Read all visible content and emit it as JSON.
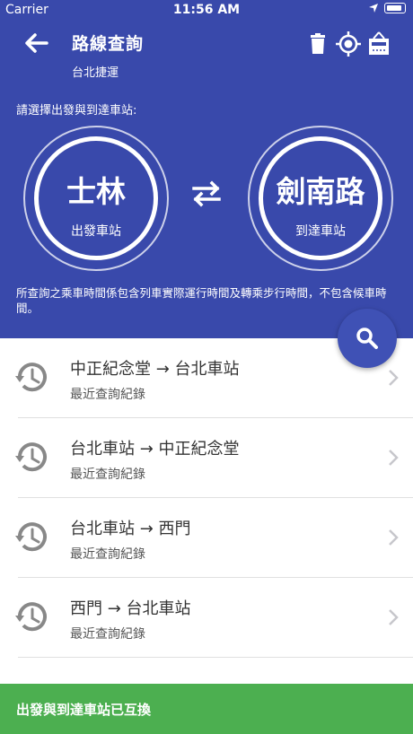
{
  "status_bar": {
    "carrier": "Carrier",
    "time": "11:56 AM"
  },
  "header": {
    "title": "路線查詢",
    "subtitle": "台北捷運",
    "instruction": "請選擇出發與到達車站:",
    "icons": [
      "back-arrow-icon",
      "trash-icon",
      "locate-icon",
      "hotel-icon"
    ]
  },
  "stations": {
    "origin": {
      "name": "士林",
      "role": "出發車站"
    },
    "destination": {
      "name": "劍南路",
      "role": "到達車站"
    }
  },
  "note": "所查詢之乘車時間係包含列車實際運行時間及轉乘步行時間，不包含候車時間。",
  "history": [
    {
      "route": "中正紀念堂 → 台北車站",
      "label": "最近查詢紀錄"
    },
    {
      "route": "台北車站 → 中正紀念堂",
      "label": "最近查詢紀錄"
    },
    {
      "route": "台北車站 → 西門",
      "label": "最近查詢紀錄"
    },
    {
      "route": "西門 → 台北車站",
      "label": "最近查詢紀錄"
    }
  ],
  "snackbar": "出發與到達車站已互換",
  "colors": {
    "primary": "#3949ab",
    "fab": "#3f51b5",
    "snackbar": "#4caf50"
  }
}
